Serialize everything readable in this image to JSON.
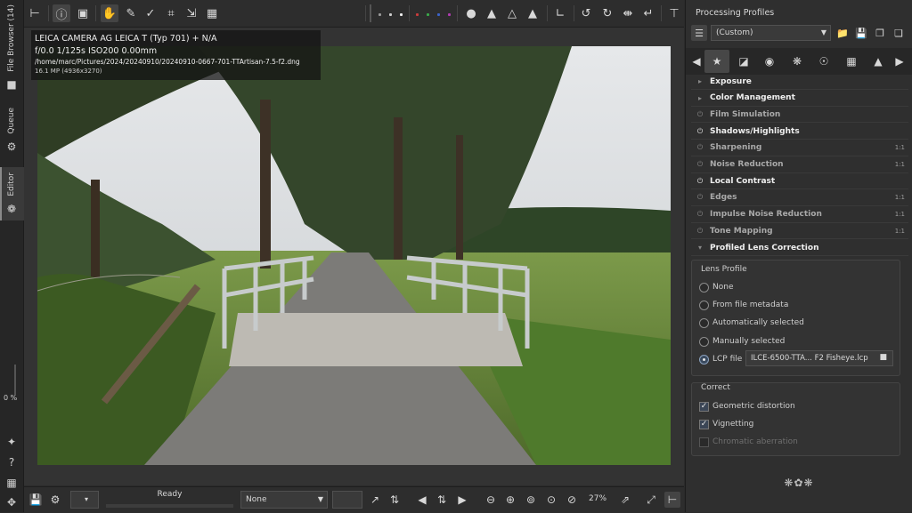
{
  "left_tabs": {
    "file_browser": "File Browser (14)",
    "queue": "Queue",
    "editor": "Editor",
    "zoom_percent": "0 %"
  },
  "toolbar": {
    "icons": [
      "top-panel-icon",
      "info-icon",
      "before-after-icon",
      "hand-icon",
      "color-picker-icon",
      "straighten-icon",
      "crop-icon",
      "transform-icon",
      "perspective-icon",
      "colors-icon",
      "clipped-highlights-icon",
      "clipped-shadows-icon",
      "histogram-icon",
      "rotate-left-icon",
      "rotate-right-icon",
      "flip-icon",
      "side-panel-icon"
    ],
    "colors": {
      "accent": "#5b7fa6",
      "red": "#c93b3b",
      "green": "#3aa84a",
      "blue": "#3b63c9",
      "magenta": "#b03bb0"
    }
  },
  "photo_info": {
    "camera": "LEICA CAMERA AG LEICA T (Typ 701) + N/A",
    "exposure": "f/0.0  1/125s  ISO200  0.00mm",
    "path": "/home/marc/Pictures/2024/20240910/20240910-0667-701-TTArtisan-7.5-f2.dng",
    "size": "16.1 MP (4936x3270)"
  },
  "bottom_bar": {
    "status": "Ready",
    "combo_value": "None",
    "zoom": "27%"
  },
  "right_panel": {
    "title": "Processing Profiles",
    "profile_value": "(Custom)",
    "sections": [
      {
        "label": "Exposure",
        "icon": "triangle-right",
        "style": "bright",
        "right": ""
      },
      {
        "label": "Color Management",
        "icon": "triangle-right",
        "style": "bright",
        "right": ""
      },
      {
        "label": "Film Simulation",
        "icon": "power-off",
        "style": "dim",
        "right": ""
      },
      {
        "label": "Shadows/Highlights",
        "icon": "power-on",
        "style": "bright",
        "right": ""
      },
      {
        "label": "Sharpening",
        "icon": "power-off",
        "style": "dim",
        "right": "1:1"
      },
      {
        "label": "Noise Reduction",
        "icon": "power-off",
        "style": "dim",
        "right": "1:1"
      },
      {
        "label": "Local Contrast",
        "icon": "power-on",
        "style": "bright",
        "right": ""
      },
      {
        "label": "Edges",
        "icon": "power-off",
        "style": "dim",
        "right": "1:1"
      },
      {
        "label": "Impulse Noise Reduction",
        "icon": "power-off",
        "style": "dim",
        "right": "1:1"
      },
      {
        "label": "Tone Mapping",
        "icon": "power-off",
        "style": "dim",
        "right": "1:1"
      },
      {
        "label": "Profiled Lens Correction",
        "icon": "triangle-down",
        "style": "bright",
        "right": ""
      }
    ],
    "lens_profile": {
      "title": "Lens Profile",
      "options": [
        "None",
        "From file metadata",
        "Automatically selected",
        "Manually selected",
        "LCP file"
      ],
      "selected": "LCP file",
      "lcp_file": "ILCE-6500-TTA...   F2 Fisheye.lcp"
    },
    "correct": {
      "title": "Correct",
      "items": [
        {
          "label": "Geometric distortion",
          "checked": true
        },
        {
          "label": "Vignetting",
          "checked": true
        },
        {
          "label": "Chromatic aberration",
          "checked": false
        }
      ]
    }
  }
}
